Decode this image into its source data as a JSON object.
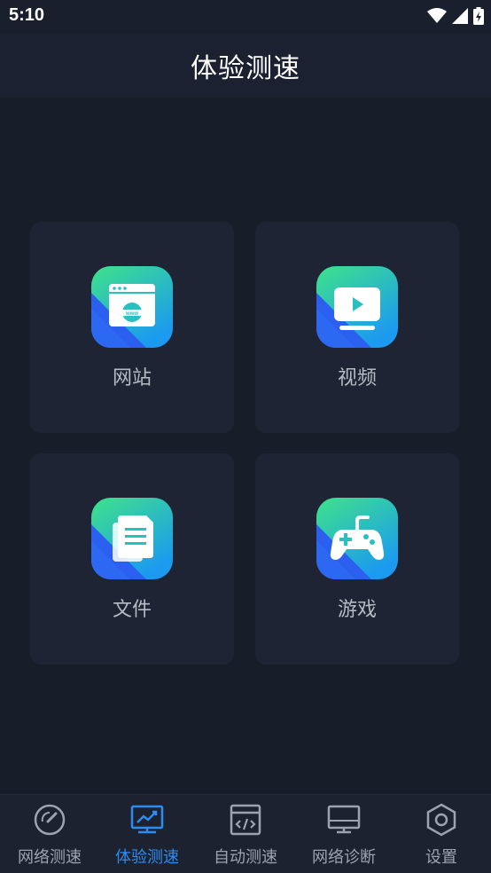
{
  "status_bar": {
    "time": "5:10"
  },
  "header": {
    "title": "体验测速"
  },
  "cards": [
    {
      "label": "网站",
      "icon": "website-icon"
    },
    {
      "label": "视频",
      "icon": "video-icon"
    },
    {
      "label": "文件",
      "icon": "file-icon"
    },
    {
      "label": "游戏",
      "icon": "gamepad-icon"
    }
  ],
  "bottom_nav": [
    {
      "label": "网络测速",
      "icon": "speedometer-icon",
      "active": false
    },
    {
      "label": "体验测速",
      "icon": "chart-monitor-icon",
      "active": true
    },
    {
      "label": "自动测速",
      "icon": "code-window-icon",
      "active": false
    },
    {
      "label": "网络诊断",
      "icon": "monitor-icon",
      "active": false
    },
    {
      "label": "设置",
      "icon": "hexagon-settings-icon",
      "active": false
    }
  ],
  "colors": {
    "background": "#181d2a",
    "card": "#1e2433",
    "accent": "#2d8cf0",
    "icon_gradient_top": "#35e08c",
    "icon_gradient_bottom": "#1f8ff5",
    "icon_stripe": "#2a5ff0"
  }
}
